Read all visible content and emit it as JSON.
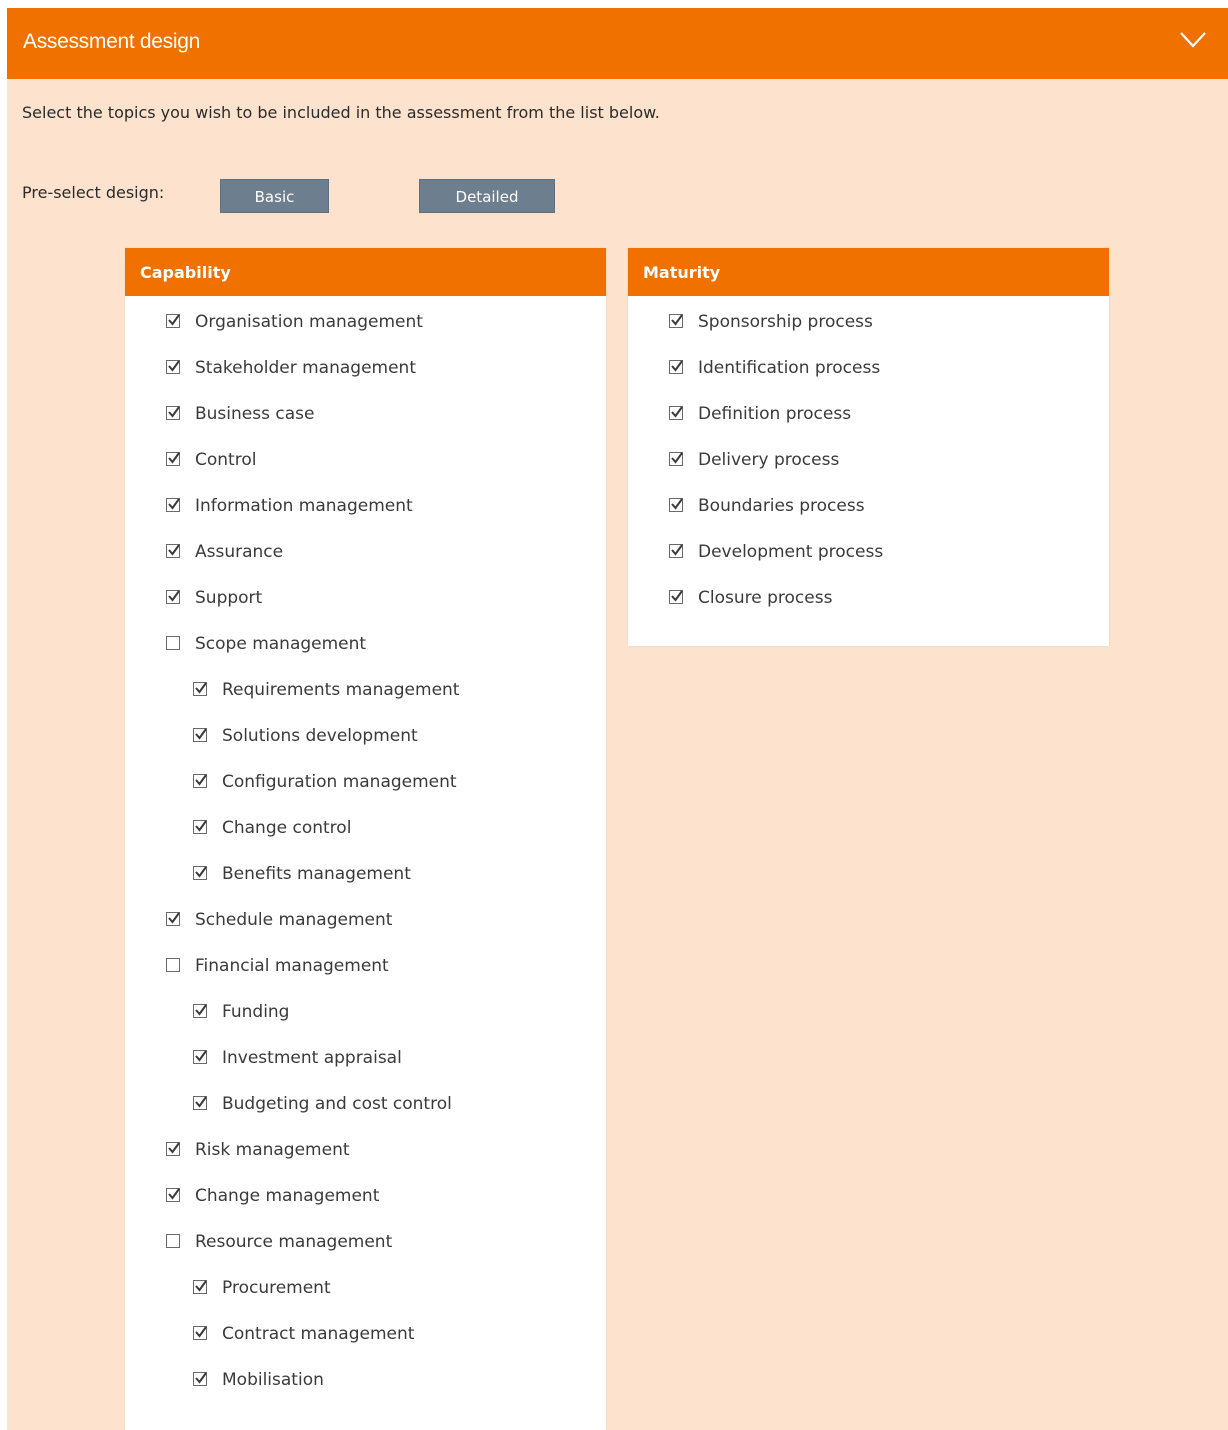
{
  "panel": {
    "title": "Assessment design",
    "intro": "Select the topics you wish to be included in the assessment from the list below.",
    "preselect_label": "Pre-select design:",
    "buttons": {
      "basic": "Basic",
      "detailed": "Detailed"
    }
  },
  "capability": {
    "title": "Capability",
    "items": [
      {
        "label": "Organisation management",
        "checked": true,
        "level": 0
      },
      {
        "label": "Stakeholder management",
        "checked": true,
        "level": 0
      },
      {
        "label": "Business case",
        "checked": true,
        "level": 0
      },
      {
        "label": "Control",
        "checked": true,
        "level": 0
      },
      {
        "label": "Information management",
        "checked": true,
        "level": 0
      },
      {
        "label": "Assurance",
        "checked": true,
        "level": 0
      },
      {
        "label": "Support",
        "checked": true,
        "level": 0
      },
      {
        "label": "Scope management",
        "checked": false,
        "level": 0
      },
      {
        "label": "Requirements management",
        "checked": true,
        "level": 1
      },
      {
        "label": "Solutions development",
        "checked": true,
        "level": 1
      },
      {
        "label": "Configuration management",
        "checked": true,
        "level": 1
      },
      {
        "label": "Change control",
        "checked": true,
        "level": 1
      },
      {
        "label": "Benefits management",
        "checked": true,
        "level": 1
      },
      {
        "label": "Schedule management",
        "checked": true,
        "level": 0
      },
      {
        "label": "Financial management",
        "checked": false,
        "level": 0
      },
      {
        "label": "Funding",
        "checked": true,
        "level": 1
      },
      {
        "label": "Investment appraisal",
        "checked": true,
        "level": 1
      },
      {
        "label": "Budgeting and cost control",
        "checked": true,
        "level": 1
      },
      {
        "label": "Risk management",
        "checked": true,
        "level": 0
      },
      {
        "label": "Change management",
        "checked": true,
        "level": 0
      },
      {
        "label": "Resource management",
        "checked": false,
        "level": 0
      },
      {
        "label": "Procurement",
        "checked": true,
        "level": 1
      },
      {
        "label": "Contract management",
        "checked": true,
        "level": 1
      },
      {
        "label": "Mobilisation",
        "checked": true,
        "level": 1
      }
    ]
  },
  "maturity": {
    "title": "Maturity",
    "items": [
      {
        "label": "Sponsorship process",
        "checked": true,
        "level": 0
      },
      {
        "label": "Identification process",
        "checked": true,
        "level": 0
      },
      {
        "label": "Definition process",
        "checked": true,
        "level": 0
      },
      {
        "label": "Delivery process",
        "checked": true,
        "level": 0
      },
      {
        "label": "Boundaries process",
        "checked": true,
        "level": 0
      },
      {
        "label": "Development process",
        "checked": true,
        "level": 0
      },
      {
        "label": "Closure process",
        "checked": true,
        "level": 0
      }
    ]
  },
  "icons": {
    "collapse": "chevron-down-icon",
    "checkbox": "checkbox-icon"
  },
  "colors": {
    "accent": "#f07000",
    "panel_bg": "#fde3cd",
    "button_bg": "#6d7e8e"
  }
}
